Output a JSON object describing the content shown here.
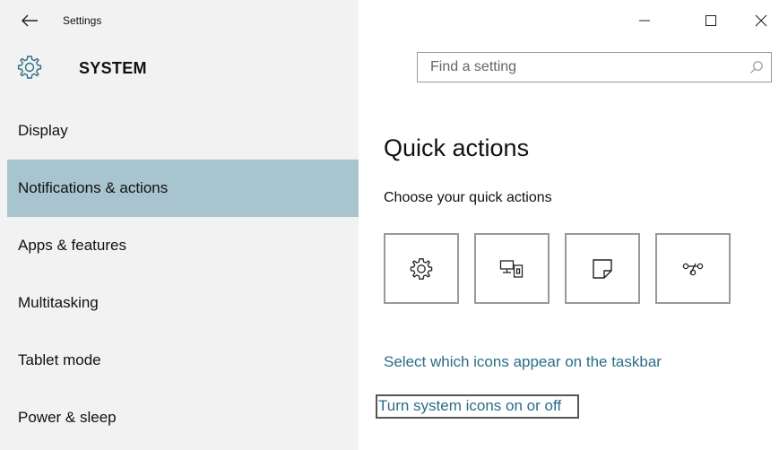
{
  "window": {
    "title": "Settings",
    "minimize_glyph": "—",
    "maximize_glyph": "☐",
    "close_glyph": "✕"
  },
  "header": {
    "section_title": "SYSTEM",
    "search_placeholder": "Find a setting"
  },
  "sidebar": {
    "items": [
      {
        "label": "Display",
        "active": false
      },
      {
        "label": "Notifications & actions",
        "active": true
      },
      {
        "label": "Apps & features",
        "active": false
      },
      {
        "label": "Multitasking",
        "active": false
      },
      {
        "label": "Tablet mode",
        "active": false
      },
      {
        "label": "Power & sleep",
        "active": false
      }
    ]
  },
  "main": {
    "title": "Quick actions",
    "subtitle": "Choose your quick actions",
    "quick_actions": [
      {
        "icon": "gear-icon"
      },
      {
        "icon": "project-icon"
      },
      {
        "icon": "note-icon"
      },
      {
        "icon": "connect-icon"
      }
    ],
    "link_taskbar_icons": "Select which icons appear on the taskbar",
    "link_system_icons": "Turn system icons on or off"
  },
  "colors": {
    "active_nav": "#a8c4ce",
    "link": "#2b6e86",
    "sidebar_bg": "#f2f2f2"
  }
}
